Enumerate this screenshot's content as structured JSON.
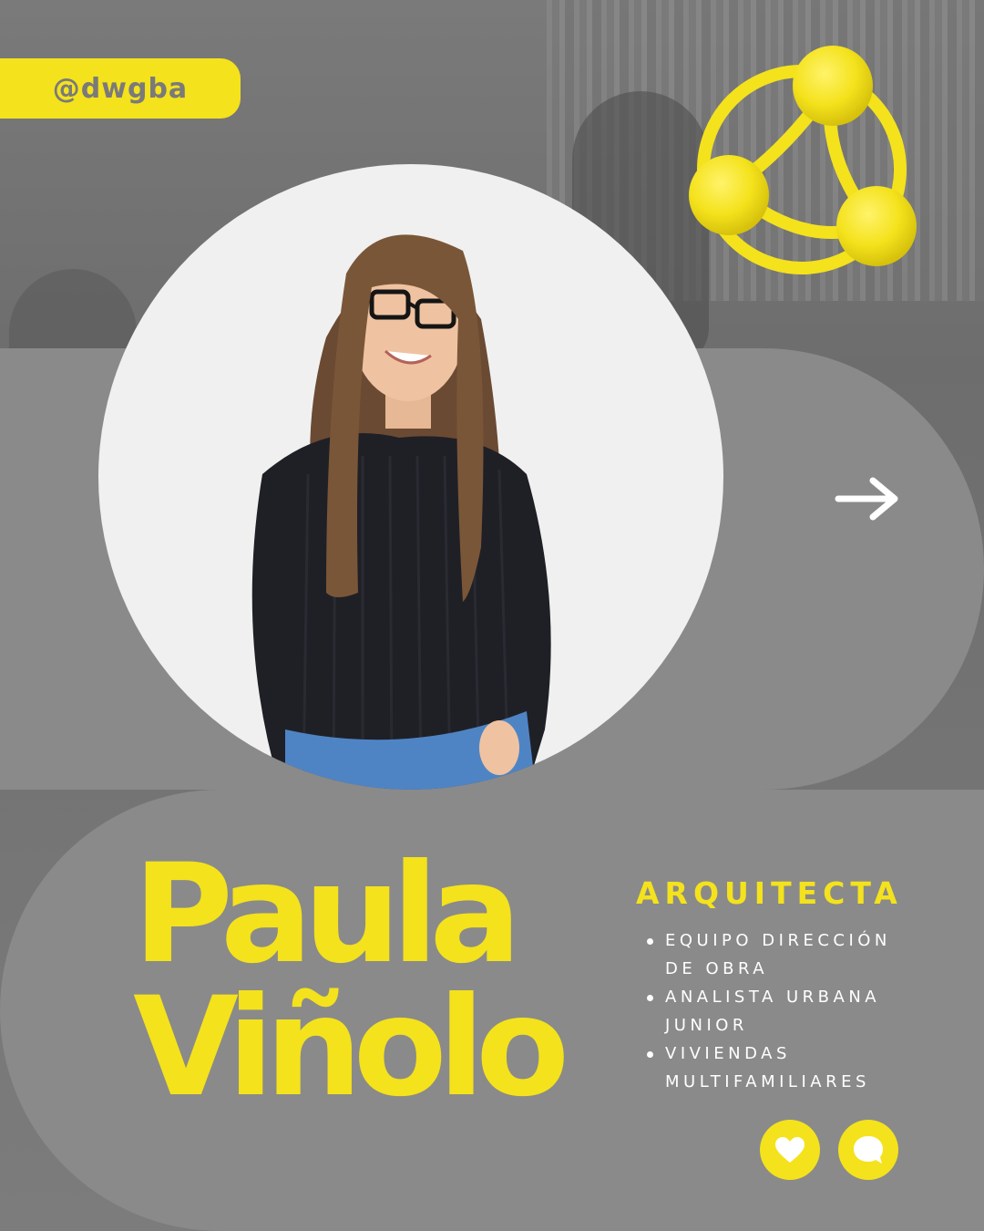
{
  "handle": "@dwgba",
  "name": {
    "first": "Paula",
    "last": "Viñolo"
  },
  "role": "ARQUITECTA",
  "duties": [
    {
      "line1": "EQUIPO DIRECCIÓN",
      "line2": "DE OBRA"
    },
    {
      "line1": "ANALISTA URBANA",
      "line2": "JUNIOR"
    },
    {
      "line1": "VIVIENDAS",
      "line2": "MULTIFAMILIARES"
    }
  ],
  "icons": {
    "logo": "three-node-network-logo",
    "next": "arrow-right-icon",
    "like": "heart-icon",
    "comment": "chat-bubble-icon"
  },
  "colors": {
    "accent": "#f4e21c",
    "panel": "#8a8a8a",
    "background": "#6f6f6f",
    "photo_bg": "#f0f0f0",
    "text_light": "#ffffff"
  }
}
